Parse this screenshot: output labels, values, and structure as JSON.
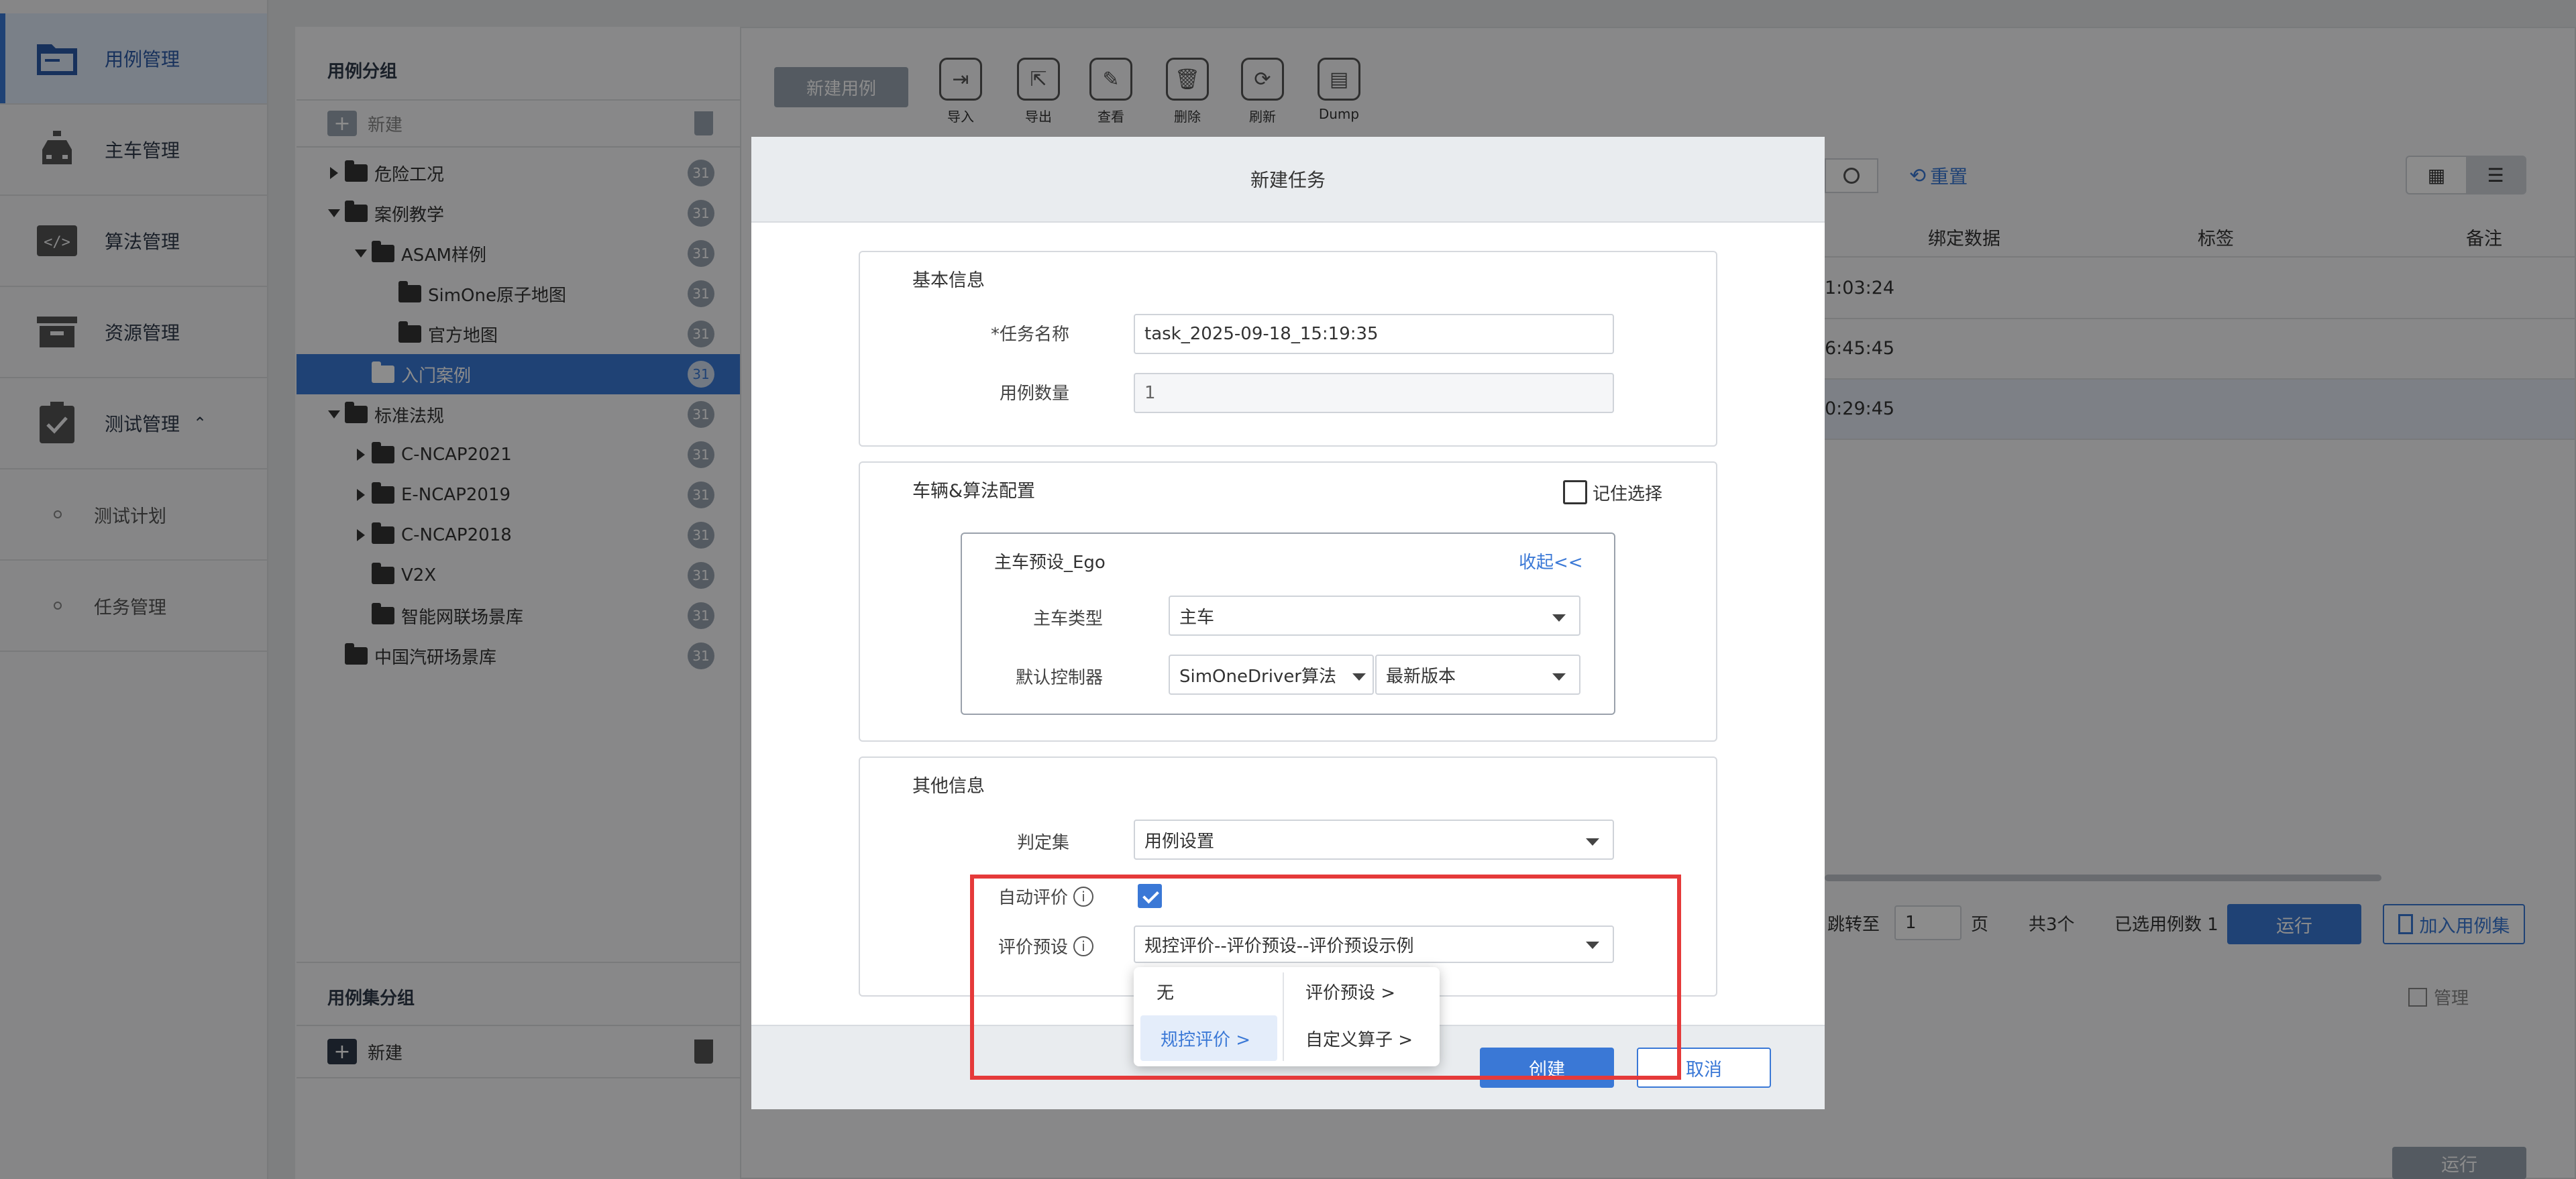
{
  "nav": {
    "items": [
      {
        "label": "用例管理",
        "icon": "folder-icon",
        "active": true
      },
      {
        "label": "主车管理",
        "icon": "car-icon"
      },
      {
        "label": "算法管理",
        "icon": "code-icon"
      },
      {
        "label": "资源管理",
        "icon": "archive-icon"
      },
      {
        "label": "测试管理",
        "icon": "clipboard-check-icon",
        "expand": "⌃"
      }
    ],
    "sub_items": [
      "测试计划",
      "任务管理"
    ]
  },
  "case_group": {
    "title": "用例分组",
    "new_label": "新建",
    "tree": [
      {
        "label": "危险工况",
        "count": "31",
        "level": 0,
        "arrow": "right"
      },
      {
        "label": "案例教学",
        "count": "31",
        "level": 0,
        "arrow": "down"
      },
      {
        "label": "ASAM样例",
        "count": "31",
        "level": 1,
        "arrow": "down"
      },
      {
        "label": "SimOne原子地图",
        "count": "31",
        "level": 2
      },
      {
        "label": "官方地图",
        "count": "31",
        "level": 2
      },
      {
        "label": "入门案例",
        "count": "31",
        "level": 1,
        "selected": true
      },
      {
        "label": "标准法规",
        "count": "31",
        "level": 0,
        "arrow": "down"
      },
      {
        "label": "C-NCAP2021",
        "count": "31",
        "level": 1,
        "arrow": "right"
      },
      {
        "label": "E-NCAP2019",
        "count": "31",
        "level": 1,
        "arrow": "right"
      },
      {
        "label": "C-NCAP2018",
        "count": "31",
        "level": 1,
        "arrow": "right"
      },
      {
        "label": "V2X",
        "count": "31",
        "level": 1
      },
      {
        "label": "智能网联场景库",
        "count": "31",
        "level": 1
      },
      {
        "label": "中国汽研场景库",
        "count": "31",
        "level": 0
      }
    ]
  },
  "caseset_group": {
    "title": "用例集分组",
    "new_label": "新建",
    "manage_label": "管理"
  },
  "toolbar": {
    "new_case": "新建用例",
    "buttons": [
      "导入",
      "导出",
      "查看",
      "删除",
      "刷新",
      "Dump"
    ]
  },
  "filter": {
    "reset_label": "重置"
  },
  "table": {
    "headers": [
      "绑定数据",
      "标签",
      "备注"
    ],
    "rows_time": [
      "1:03:24",
      "6:45:45",
      "0:29:45"
    ]
  },
  "pagination": {
    "goto_label": "跳转至",
    "page_value": "1",
    "page_unit": "页",
    "total": "共3个",
    "selected": "已选用例数 1",
    "run": "运行",
    "add_to_set": "加入用例集",
    "run_bottom": "运行"
  },
  "dialog": {
    "title": "新建任务",
    "basic": {
      "title": "基本信息",
      "task_name_label": "*任务名称",
      "task_name_value": "task_2025-09-18_15:19:35",
      "case_count_label": "用例数量",
      "case_count_value": "1"
    },
    "vehicle": {
      "title": "车辆&算法配置",
      "remember_label": "记住选择",
      "preset_title": "主车预设_Ego",
      "collapse_label": "收起<<",
      "type_label": "主车类型",
      "type_value": "主车",
      "controller_label": "默认控制器",
      "controller_value": "SimOneDriver算法",
      "version_value": "最新版本"
    },
    "other": {
      "title": "其他信息",
      "judge_label": "判定集",
      "judge_value": "用例设置",
      "auto_eval_label": "自动评价",
      "eval_preset_label": "评价预设",
      "eval_preset_value": "规控评价--评价预设--评价预设示例"
    },
    "cascade": {
      "col1": [
        "无",
        "规控评价  >"
      ],
      "col2": [
        "评价预设     >",
        "自定义算子 >"
      ]
    },
    "create": "创建",
    "cancel": "取消"
  }
}
